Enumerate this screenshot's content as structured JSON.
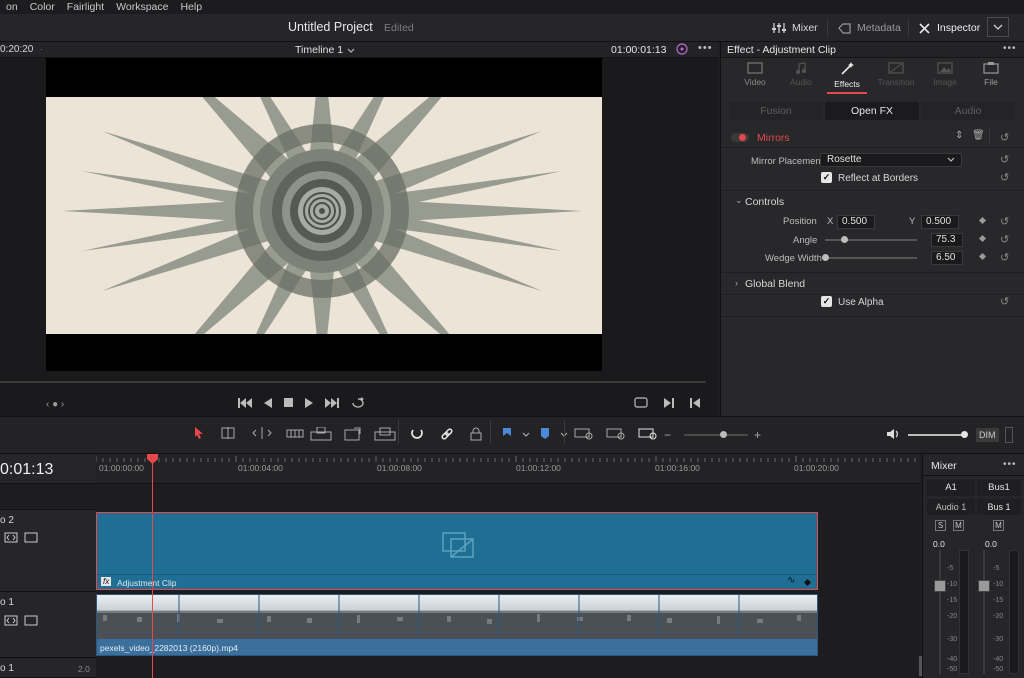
{
  "menu": [
    "on",
    "Color",
    "Fairlight",
    "Workspace",
    "Help"
  ],
  "project": {
    "title": "Untitled Project",
    "status": "Edited"
  },
  "top_buttons": {
    "mixer": "Mixer",
    "metadata": "Metadata",
    "inspector": "Inspector"
  },
  "viewer": {
    "left_timecode": "0:20:20",
    "timeline_name": "Timeline 1",
    "timecode": "01:00:01:13"
  },
  "inspector": {
    "title": "Effect - Adjustment Clip",
    "tabs": [
      {
        "label": "Video",
        "icon": "video-icon",
        "active": false
      },
      {
        "label": "Audio",
        "icon": "audio-icon",
        "active": false
      },
      {
        "label": "Effects",
        "icon": "effects-wand-icon",
        "active": true
      },
      {
        "label": "Transition",
        "icon": "transition-icon",
        "active": false
      },
      {
        "label": "Image",
        "icon": "image-icon",
        "active": false
      },
      {
        "label": "File",
        "icon": "file-icon",
        "active": false
      }
    ],
    "subtabs": [
      "Fusion",
      "Open FX",
      "Audio"
    ],
    "active_subtab": "Open FX",
    "effect_name": "Mirrors",
    "mirror_placement_label": "Mirror Placement",
    "mirror_placement_value": "Rosette",
    "reflect_label": "Reflect at Borders",
    "controls_label": "Controls",
    "position_label": "Position",
    "x_label": "X",
    "x_value": "0.500",
    "y_label": "Y",
    "y_value": "0.500",
    "angle_label": "Angle",
    "angle_value": "75.3",
    "angle_level": 0.21,
    "wedge_label": "Wedge Width",
    "wedge_value": "6.50",
    "wedge_level": 0.0,
    "global_blend_label": "Global Blend",
    "use_alpha_label": "Use Alpha"
  },
  "timeline": {
    "timecode": "0:01:13",
    "ruler_ticks": [
      "01:00:00:00",
      "01:00:04:00",
      "01:00:08:00",
      "01:00:12:00",
      "01:00:16:00",
      "01:00:20:00"
    ],
    "tracks": [
      {
        "name": "o 2"
      },
      {
        "name": "o 1"
      },
      {
        "name": "o 1",
        "extra": "2.0"
      }
    ],
    "adjustment_clip_label": "Adjustment Clip",
    "fx_badge": "fx",
    "video_clip_label": "pexels_video_2282013 (2160p).mp4",
    "playhead_level": 0.068
  },
  "mixer": {
    "title": "Mixer",
    "channels": [
      {
        "name": "A1",
        "track": "Audio 1",
        "level": "0.0"
      },
      {
        "name": "Bus1",
        "track": "Bus 1",
        "level": "0.0"
      }
    ],
    "solo": "S",
    "mute": "M",
    "scale": [
      "-5",
      "-10",
      "-15",
      "-20",
      "-30",
      "-40",
      "-50"
    ]
  },
  "toolbar": {
    "dim_label": "DIM"
  },
  "colors": {
    "accent_red": "#e5484d",
    "clip_blue": "#1f6f95",
    "video_blue": "#3b6f9c",
    "active_tab_red": "#e5484d"
  }
}
